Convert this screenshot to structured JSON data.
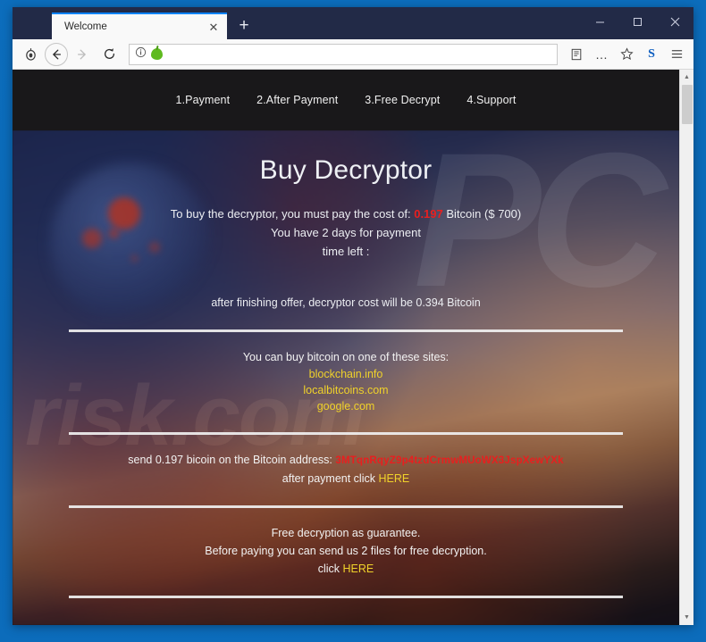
{
  "window": {
    "tab_title": "Welcome",
    "tab_close_label": "✕",
    "new_tab_label": "+",
    "minimize_label": "minimize",
    "maximize_label": "maximize",
    "close_label": "close"
  },
  "toolbar": {
    "tor_icon_name": "tor-onion-icon",
    "back_label": "←",
    "forward_label": "→",
    "reload_label": "⟳",
    "url_value": "",
    "url_placeholder": "",
    "reader_label": "reader-view",
    "ellipsis_label": "…",
    "star_label": "☆",
    "skype_label": "S",
    "menu_label": "☰"
  },
  "page": {
    "nav": [
      {
        "label": "1.Payment"
      },
      {
        "label": "2.After Payment"
      },
      {
        "label": "3.Free Decrypt"
      },
      {
        "label": "4.Support"
      }
    ],
    "title": "Buy Decryptor",
    "cost_prefix": "To buy the decryptor, you must pay the cost of:",
    "cost_amount": "0.197",
    "cost_suffix": "Bitcoin ($ 700)",
    "days_line": "You have 2 days for payment",
    "timer_label": "time left :",
    "timer_value": "",
    "after_offer": "after finishing offer, decryptor cost will be 0.394 Bitcoin",
    "buy_sites_label": "You can buy bitcoin on one of these sites:",
    "sites": [
      {
        "label": "blockchain.info"
      },
      {
        "label": "localbitcoins.com"
      },
      {
        "label": "google.com"
      }
    ],
    "send_prefix": "send 0.197 bicoin on the Bitcoin address:",
    "btc_address": "3MTqnRqyZ9p4tzdCrmwMUoWX3JspXewYXk",
    "after_payment_prefix": "after payment click",
    "after_payment_link": "HERE",
    "guarantee_title": "Free decryption as guarantee.",
    "guarantee_text": "Before paying you can send us 2 files for free decryption.",
    "click_prefix": "click",
    "click_link": "HERE",
    "watermark_pc": "PC",
    "watermark_risk": "risk.com"
  },
  "colors": {
    "accent_red": "#e81f1f",
    "link_yellow": "#f0d22a",
    "tab_accent": "#0a84ff",
    "desktop_blue": "#0c6dbc"
  },
  "scrollbar": {
    "up_label": "▲",
    "down_label": "▼"
  }
}
